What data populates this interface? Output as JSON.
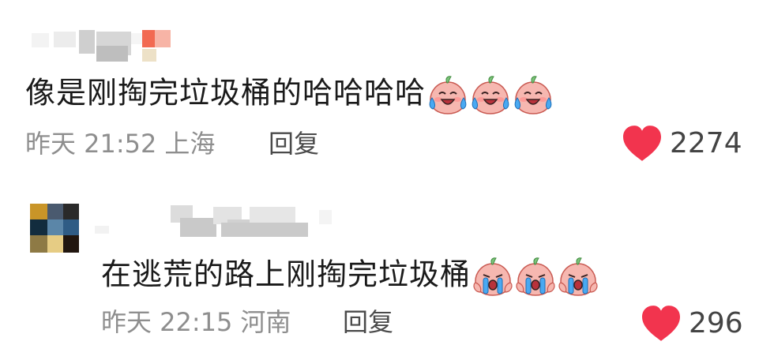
{
  "colors": {
    "heart": "#f2344e",
    "meta_text": "#8e8e8e",
    "body_text": "#1a1a1a"
  },
  "comments": [
    {
      "text": "像是刚掏完垃圾桶的哈哈哈哈",
      "emojis": [
        "crying-laugh-peach-emoji",
        "crying-laugh-peach-emoji",
        "crying-laugh-peach-emoji"
      ],
      "time": "昨天 21:52",
      "location": "上海",
      "reply_label": "回复",
      "likes": "2274"
    },
    {
      "text": "在逃荒的路上刚掏完垃圾桶",
      "emojis": [
        "sobbing-peach-emoji",
        "sobbing-peach-emoji",
        "sobbing-peach-emoji"
      ],
      "time": "昨天 22:15",
      "location": "河南",
      "reply_label": "回复",
      "likes": "296"
    }
  ]
}
